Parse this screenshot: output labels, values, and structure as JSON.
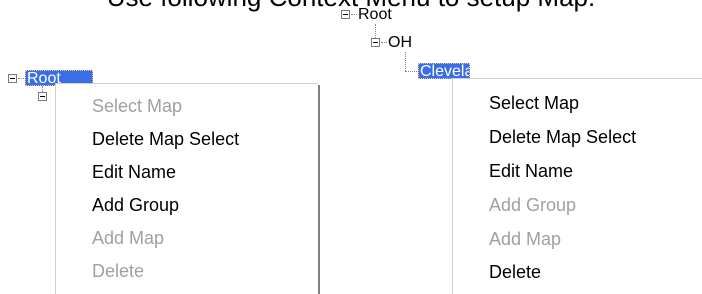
{
  "heading_fragment": "Use following Context Menu to setup Map:",
  "colors": {
    "selection": "#3a6ee8",
    "menu_enabled_text": "#000000",
    "menu_disabled_text": "#a0a0a0"
  },
  "left_panel": {
    "tree": {
      "root_label": "Root"
    },
    "context_menu": {
      "items": [
        {
          "label": "Select Map",
          "enabled": false
        },
        {
          "label": "Delete Map Select",
          "enabled": true
        },
        {
          "label": "Edit Name",
          "enabled": true
        },
        {
          "label": "Add Group",
          "enabled": true
        },
        {
          "label": "Add Map",
          "enabled": false
        },
        {
          "label": "Delete",
          "enabled": false
        }
      ]
    }
  },
  "right_panel": {
    "tree": {
      "root_label": "Root",
      "child_label": "OH",
      "leaf_label": "Cleveland"
    },
    "context_menu": {
      "items": [
        {
          "label": "Select Map",
          "enabled": true
        },
        {
          "label": "Delete Map Select",
          "enabled": true
        },
        {
          "label": "Edit Name",
          "enabled": true
        },
        {
          "label": "Add Group",
          "enabled": false
        },
        {
          "label": "Add Map",
          "enabled": false
        },
        {
          "label": "Delete",
          "enabled": true
        }
      ]
    }
  }
}
